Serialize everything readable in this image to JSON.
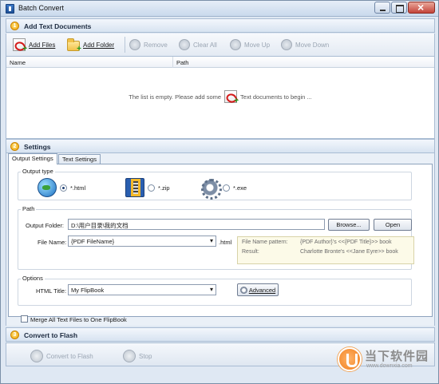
{
  "window": {
    "title": "Batch Convert"
  },
  "sections": {
    "add": {
      "number": "1",
      "title": "Add Text Documents"
    },
    "settings": {
      "number": "2",
      "title": "Settings"
    },
    "convert": {
      "number": "3",
      "title": "Convert to Flash"
    }
  },
  "toolbar": {
    "add_files": "Add Files",
    "add_folder": "Add Folder",
    "remove": "Remove",
    "clear_all": "Clear All",
    "move_up": "Move Up",
    "move_down": "Move Down"
  },
  "file_list": {
    "columns": [
      "Name",
      "Path"
    ],
    "empty_before": "The list is empty. Please add some",
    "empty_after": "Text documents to begin ..."
  },
  "settings_tabs": [
    "Output Settings",
    "Text Settings"
  ],
  "output_type": {
    "title": "Output type",
    "options": [
      {
        "label": "*.html",
        "selected": true,
        "icon": "globe-icon"
      },
      {
        "label": "*.zip",
        "selected": false,
        "icon": "zip-icon"
      },
      {
        "label": "*.exe",
        "selected": false,
        "icon": "exe-icon"
      }
    ]
  },
  "path": {
    "title": "Path",
    "output_folder_label": "Output Folder:",
    "output_folder_value": "D:\\用户目录\\我的文档",
    "browse_label": "Browse...",
    "open_label": "Open",
    "file_name_label": "File Name:",
    "file_name_value": "{PDF FileName}",
    "file_ext": ".html",
    "pattern_label": "File Name pattern:",
    "pattern_value": "{PDF Author}'s <<{PDF Title}>> book",
    "result_label": "Result:",
    "result_value": "Charlotte Bronte's <<Jane Eyre>> book"
  },
  "options": {
    "title": "Options",
    "html_title_label": "HTML Title:",
    "html_title_value": "My FlipBook",
    "advanced_label": "Advanced"
  },
  "merge": {
    "label": "Merge All Text Files to One FlipBook",
    "checked": false
  },
  "bottom": {
    "convert_label": "Convert to Flash",
    "stop_label": "Stop"
  },
  "watermark": {
    "text": "当下软件园",
    "url": "www.downxia.com"
  }
}
